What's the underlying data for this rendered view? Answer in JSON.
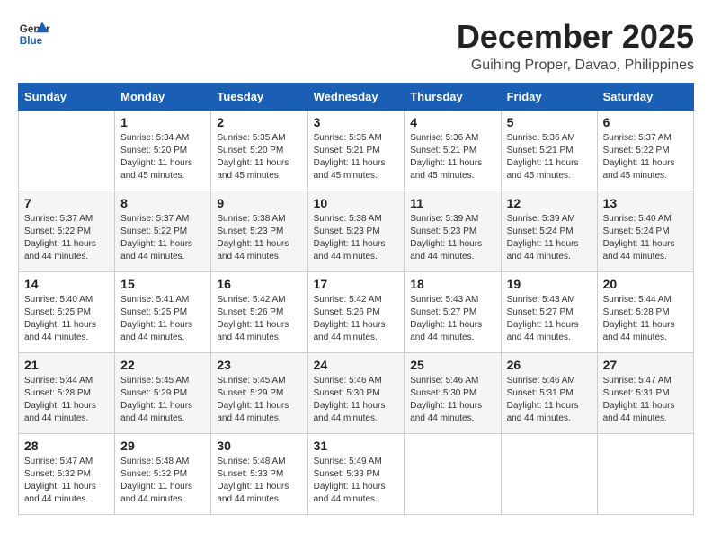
{
  "header": {
    "logo_line1": "General",
    "logo_line2": "Blue",
    "month_year": "December 2025",
    "location": "Guihing Proper, Davao, Philippines"
  },
  "days_of_week": [
    "Sunday",
    "Monday",
    "Tuesday",
    "Wednesday",
    "Thursday",
    "Friday",
    "Saturday"
  ],
  "weeks": [
    [
      {
        "day": "",
        "info": ""
      },
      {
        "day": "1",
        "info": "Sunrise: 5:34 AM\nSunset: 5:20 PM\nDaylight: 11 hours\nand 45 minutes."
      },
      {
        "day": "2",
        "info": "Sunrise: 5:35 AM\nSunset: 5:20 PM\nDaylight: 11 hours\nand 45 minutes."
      },
      {
        "day": "3",
        "info": "Sunrise: 5:35 AM\nSunset: 5:21 PM\nDaylight: 11 hours\nand 45 minutes."
      },
      {
        "day": "4",
        "info": "Sunrise: 5:36 AM\nSunset: 5:21 PM\nDaylight: 11 hours\nand 45 minutes."
      },
      {
        "day": "5",
        "info": "Sunrise: 5:36 AM\nSunset: 5:21 PM\nDaylight: 11 hours\nand 45 minutes."
      },
      {
        "day": "6",
        "info": "Sunrise: 5:37 AM\nSunset: 5:22 PM\nDaylight: 11 hours\nand 45 minutes."
      }
    ],
    [
      {
        "day": "7",
        "info": "Sunrise: 5:37 AM\nSunset: 5:22 PM\nDaylight: 11 hours\nand 44 minutes."
      },
      {
        "day": "8",
        "info": "Sunrise: 5:37 AM\nSunset: 5:22 PM\nDaylight: 11 hours\nand 44 minutes."
      },
      {
        "day": "9",
        "info": "Sunrise: 5:38 AM\nSunset: 5:23 PM\nDaylight: 11 hours\nand 44 minutes."
      },
      {
        "day": "10",
        "info": "Sunrise: 5:38 AM\nSunset: 5:23 PM\nDaylight: 11 hours\nand 44 minutes."
      },
      {
        "day": "11",
        "info": "Sunrise: 5:39 AM\nSunset: 5:23 PM\nDaylight: 11 hours\nand 44 minutes."
      },
      {
        "day": "12",
        "info": "Sunrise: 5:39 AM\nSunset: 5:24 PM\nDaylight: 11 hours\nand 44 minutes."
      },
      {
        "day": "13",
        "info": "Sunrise: 5:40 AM\nSunset: 5:24 PM\nDaylight: 11 hours\nand 44 minutes."
      }
    ],
    [
      {
        "day": "14",
        "info": "Sunrise: 5:40 AM\nSunset: 5:25 PM\nDaylight: 11 hours\nand 44 minutes."
      },
      {
        "day": "15",
        "info": "Sunrise: 5:41 AM\nSunset: 5:25 PM\nDaylight: 11 hours\nand 44 minutes."
      },
      {
        "day": "16",
        "info": "Sunrise: 5:42 AM\nSunset: 5:26 PM\nDaylight: 11 hours\nand 44 minutes."
      },
      {
        "day": "17",
        "info": "Sunrise: 5:42 AM\nSunset: 5:26 PM\nDaylight: 11 hours\nand 44 minutes."
      },
      {
        "day": "18",
        "info": "Sunrise: 5:43 AM\nSunset: 5:27 PM\nDaylight: 11 hours\nand 44 minutes."
      },
      {
        "day": "19",
        "info": "Sunrise: 5:43 AM\nSunset: 5:27 PM\nDaylight: 11 hours\nand 44 minutes."
      },
      {
        "day": "20",
        "info": "Sunrise: 5:44 AM\nSunset: 5:28 PM\nDaylight: 11 hours\nand 44 minutes."
      }
    ],
    [
      {
        "day": "21",
        "info": "Sunrise: 5:44 AM\nSunset: 5:28 PM\nDaylight: 11 hours\nand 44 minutes."
      },
      {
        "day": "22",
        "info": "Sunrise: 5:45 AM\nSunset: 5:29 PM\nDaylight: 11 hours\nand 44 minutes."
      },
      {
        "day": "23",
        "info": "Sunrise: 5:45 AM\nSunset: 5:29 PM\nDaylight: 11 hours\nand 44 minutes."
      },
      {
        "day": "24",
        "info": "Sunrise: 5:46 AM\nSunset: 5:30 PM\nDaylight: 11 hours\nand 44 minutes."
      },
      {
        "day": "25",
        "info": "Sunrise: 5:46 AM\nSunset: 5:30 PM\nDaylight: 11 hours\nand 44 minutes."
      },
      {
        "day": "26",
        "info": "Sunrise: 5:46 AM\nSunset: 5:31 PM\nDaylight: 11 hours\nand 44 minutes."
      },
      {
        "day": "27",
        "info": "Sunrise: 5:47 AM\nSunset: 5:31 PM\nDaylight: 11 hours\nand 44 minutes."
      }
    ],
    [
      {
        "day": "28",
        "info": "Sunrise: 5:47 AM\nSunset: 5:32 PM\nDaylight: 11 hours\nand 44 minutes."
      },
      {
        "day": "29",
        "info": "Sunrise: 5:48 AM\nSunset: 5:32 PM\nDaylight: 11 hours\nand 44 minutes."
      },
      {
        "day": "30",
        "info": "Sunrise: 5:48 AM\nSunset: 5:33 PM\nDaylight: 11 hours\nand 44 minutes."
      },
      {
        "day": "31",
        "info": "Sunrise: 5:49 AM\nSunset: 5:33 PM\nDaylight: 11 hours\nand 44 minutes."
      },
      {
        "day": "",
        "info": ""
      },
      {
        "day": "",
        "info": ""
      },
      {
        "day": "",
        "info": ""
      }
    ]
  ]
}
